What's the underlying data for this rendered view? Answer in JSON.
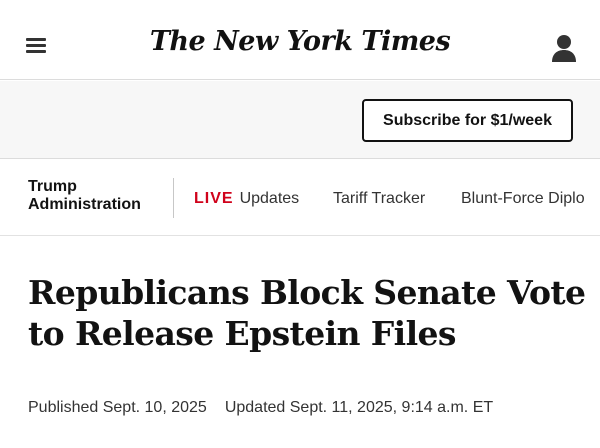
{
  "masthead": {
    "logo_text": "The New York Times",
    "menu_icon": "hamburger-menu-icon",
    "account_icon": "user-account-icon"
  },
  "subscribe": {
    "label": "Subscribe for $1/week"
  },
  "section_nav": {
    "section_line1": "Trump",
    "section_line2": "Administration",
    "live_label": "LIVE",
    "items": [
      "Updates",
      "Tariff Tracker",
      "Blunt-Force Diplo"
    ]
  },
  "article": {
    "headline": "Republicans Block Senate Vote to Release Epstein Files",
    "published": "Published Sept. 10, 2025",
    "updated": "Updated Sept. 11, 2025, 9:14 a.m. ET"
  },
  "colors": {
    "live_red": "#d0021b",
    "text": "#121212",
    "band_bg": "#f7f7f7"
  }
}
